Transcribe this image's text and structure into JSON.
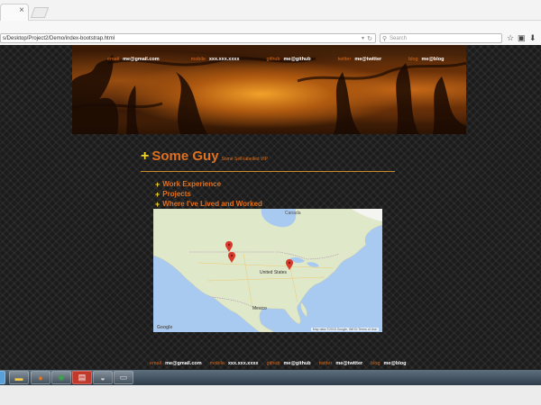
{
  "browser": {
    "url": "s/Desktop/Project2/Demo/index-bootstrap.html",
    "search_placeholder": "Search",
    "tab_close": "×",
    "icons": [
      "star-icon",
      "clipboard-icon",
      "download-icon"
    ]
  },
  "contacts": [
    {
      "label": "email",
      "value": "me@gmail.com"
    },
    {
      "label": "mobile",
      "value": "xxx.xxx.xxxx"
    },
    {
      "label": "github",
      "value": "me@github"
    },
    {
      "label": "twitter",
      "value": "me@twitter"
    },
    {
      "label": "blog",
      "value": "me@blog"
    }
  ],
  "profile": {
    "name": "Some Guy",
    "subtitle": "Some Self-labelled VIP"
  },
  "nav": [
    {
      "label": "Work Experience"
    },
    {
      "label": "Projects"
    },
    {
      "label": "Where I've Lived and Worked"
    }
  ],
  "map": {
    "labels": {
      "canada": "Canada",
      "united_states": "United States",
      "mexico": "Mexico"
    },
    "attribution": "Map data ©2015 Google, INEGI   Terms of Use",
    "logo": "Google",
    "markers": 3
  },
  "colors": {
    "accent": "#e0701e",
    "plus": "#f2d52a",
    "background": "#1b1b1b",
    "water": "#a8c9f0",
    "land": "#dfe9c9"
  }
}
